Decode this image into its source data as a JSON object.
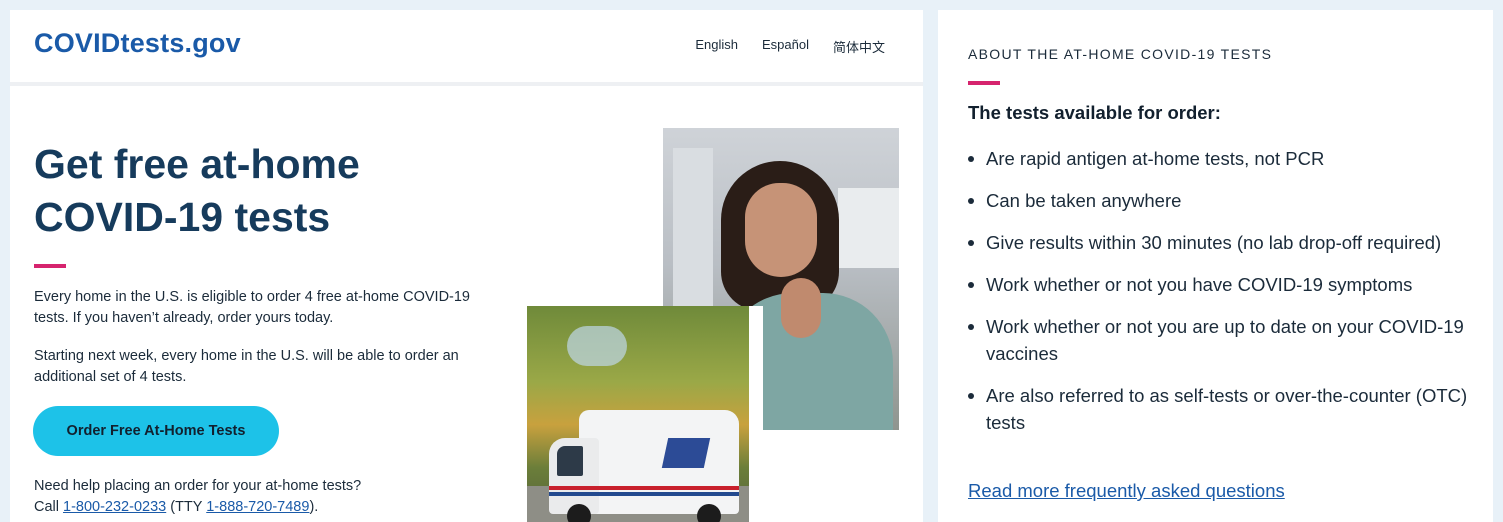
{
  "header": {
    "logo": "COVIDtests.gov",
    "languages": [
      "English",
      "Español",
      "简体中文"
    ]
  },
  "hero": {
    "title": "Get free at-home COVID-19 tests",
    "paragraph_1": "Every home in the U.S. is eligible to order 4 free at-home COVID-19 tests. If you haven’t already, order yours today.",
    "paragraph_2": "Starting next week, every home in the U.S. will be able to order an additional set of 4 tests.",
    "order_button": "Order Free At-Home Tests",
    "help_line_1": "Need help placing an order for your at-home tests?",
    "help_call": "Call",
    "help_phone": "1-800-232-0233",
    "help_tty_prefix": "(TTY",
    "help_tty": "1-888-720-7489",
    "help_suffix": ")."
  },
  "about": {
    "heading": "ABOUT THE AT-HOME COVID-19 TESTS",
    "subtitle": "The tests available for order:",
    "items": [
      "Are rapid antigen at-home tests, not PCR",
      "Can be taken anywhere",
      "Give results within 30 minutes (no lab drop-off required)",
      "Work whether or not you have COVID-19 symptoms",
      "Work whether or not you are up to date on your COVID-19 vaccines",
      "Are also referred to as self-tests or over-the-counter (OTC) tests"
    ],
    "faq_link": "Read more frequently asked questions"
  },
  "colors": {
    "brand_blue": "#1a5aa8",
    "heading_navy": "#163b5c",
    "accent_magenta": "#d6246e",
    "button_cyan": "#1dc2e8"
  }
}
